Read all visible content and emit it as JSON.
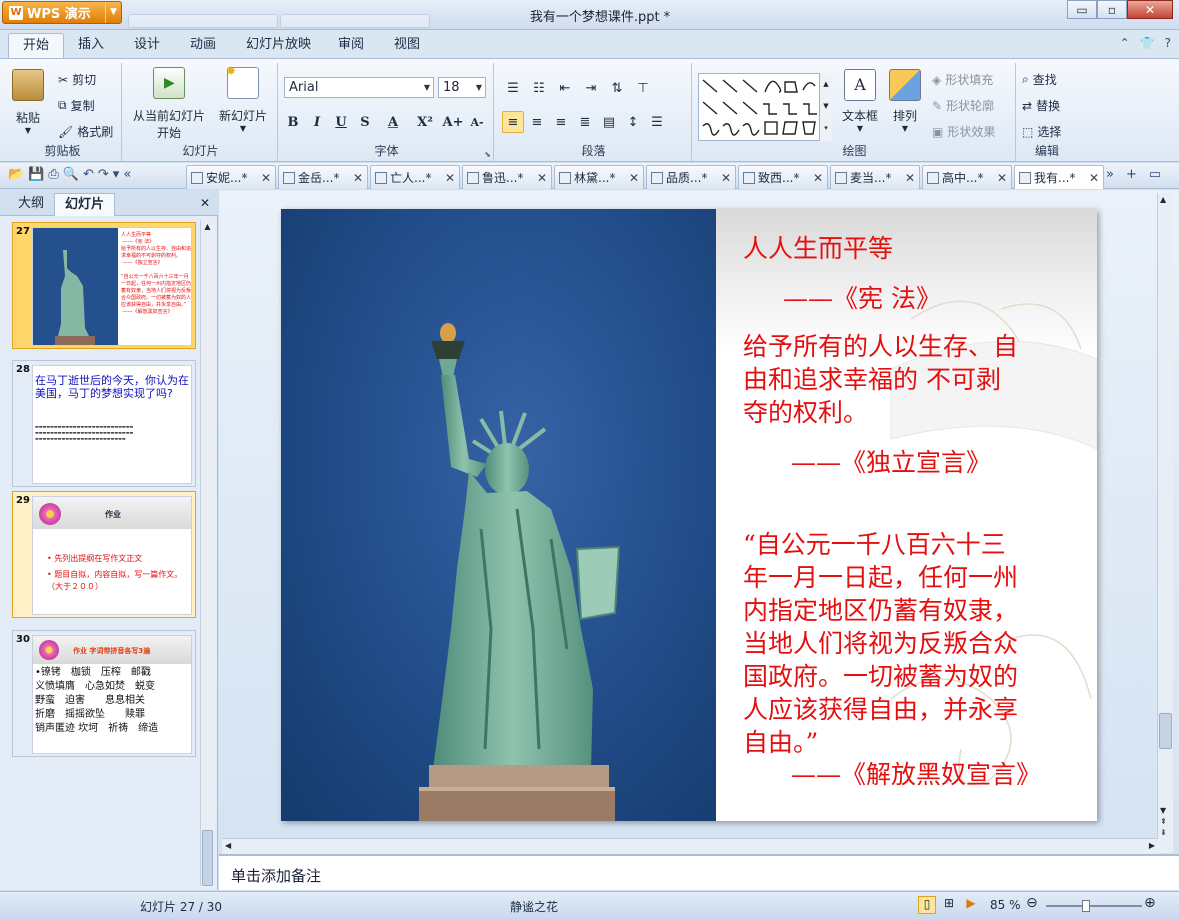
{
  "app": {
    "button_label": "WPS 演示",
    "window_title": "我有一个梦想课件.ppt *",
    "min_glyph": "▭",
    "max_glyph": "▫",
    "close_glyph": "✕"
  },
  "menu": {
    "tabs": [
      "开始",
      "插入",
      "设计",
      "动画",
      "幻灯片放映",
      "审阅",
      "视图"
    ]
  },
  "ribbon": {
    "clipboard": {
      "paste": "粘贴",
      "cut": "剪切",
      "copy": "复制",
      "format_painter": "格式刷",
      "group": "剪贴板"
    },
    "slides": {
      "from_current_line1": "从当前幻灯片",
      "from_current_line2": "开始",
      "new_slide": "新幻灯片",
      "group": "幻灯片"
    },
    "font": {
      "name": "Arial",
      "size": "18",
      "bold": "B",
      "italic": "I",
      "underline": "U",
      "strike": "S",
      "color": "A",
      "superscript": "X²",
      "grow": "A+",
      "shrink": "A-",
      "group": "字体"
    },
    "paragraph": {
      "group": "段落"
    },
    "drawing": {
      "textbox": "文本框",
      "arrange": "排列",
      "shape_fill": "形状填充",
      "shape_outline": "形状轮廓",
      "shape_effect": "形状效果",
      "group": "绘图"
    },
    "editing": {
      "find": "查找",
      "replace": "替换",
      "select": "选择",
      "group": "编辑"
    }
  },
  "doc_tabs": [
    "安妮...*",
    "金岳...*",
    "亡人...*",
    "鲁迅...*",
    "林黛...*",
    "品质...*",
    "致西...*",
    "麦当...*",
    "高中...*",
    "我有...*"
  ],
  "panel": {
    "tab_outline": "大纲",
    "tab_slides": "幻灯片",
    "close": "✕"
  },
  "thumbs": [
    {
      "num": "27"
    },
    {
      "num": "28",
      "title": "在马丁逝世后的今天，你认为在美国，马丁的梦想实现了吗?"
    },
    {
      "num": "29",
      "title": "作业",
      "b1": "• 先列出提纲在写作文正文",
      "b2": "• 题目自拟，内容自拟，写一篇作文。（大于２００）"
    },
    {
      "num": "30",
      "title": "作业 字词带拼音各写3遍",
      "words": [
        "•镣铐　枷锁　压榨　邮戳",
        "义愤填膺　心急如焚　蜕变",
        "野蛮　迫害　　息息相关",
        "折磨　摇摇欲坠　　赎罪",
        "销声匿迹 坎坷　祈祷　缔造"
      ]
    }
  ],
  "slide": {
    "line1": "人人生而平等",
    "line2": "——《宪  法》",
    "line3a": "给予所有的人以生存、自",
    "line3b": "由和追求幸福的 不可剥",
    "line3c": "夺的权利。",
    "line4": "——《独立宣言》",
    "q1": "“自公元一千八百六十三",
    "q2": "年一月一日起，任何一州",
    "q3": "内指定地区仍蓄有奴隶，",
    "q4": "当地人们将视为反叛合众",
    "q5": "国政府。一切被蓄为奴的",
    "q6": "人应该获得自由，并永享",
    "q7": "自由。”",
    "line5": "——《解放黑奴宣言》"
  },
  "notes": {
    "placeholder": "单击添加备注"
  },
  "status": {
    "slide_counter": "幻灯片 27 / 30",
    "theme": "静谧之花",
    "zoom": "85 %"
  },
  "colors": {
    "slide_text": "#e41010",
    "accent": "#e07d07"
  }
}
